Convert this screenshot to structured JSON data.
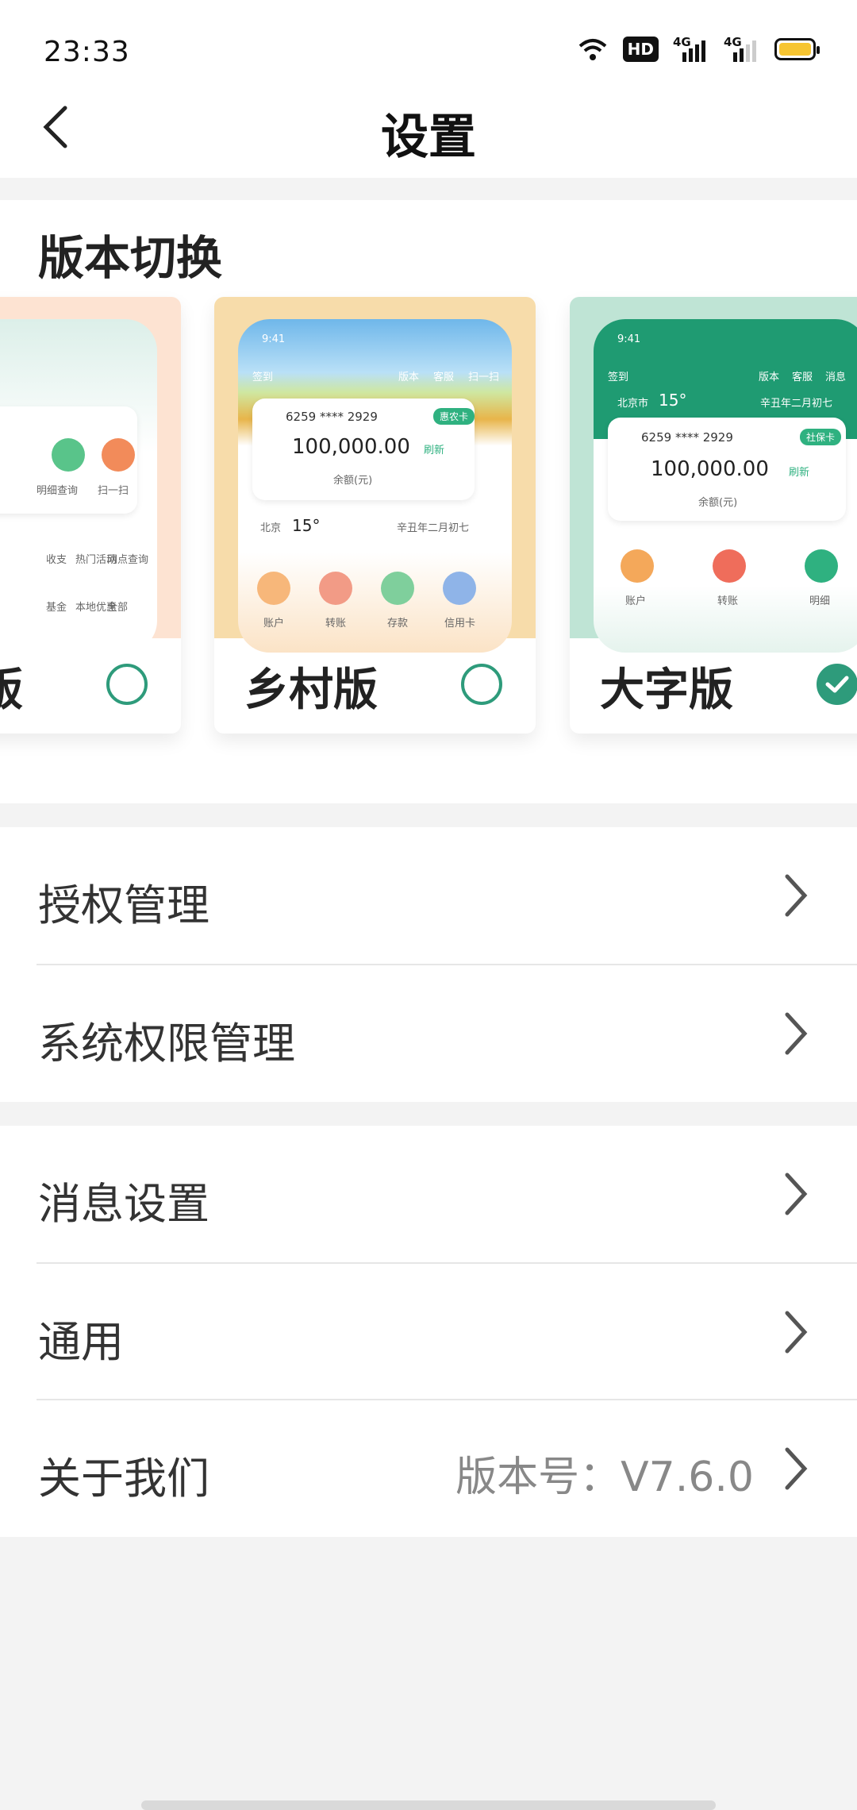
{
  "status_bar": {
    "time": "23:33",
    "hd_label": "HD",
    "network_label": "4G"
  },
  "header": {
    "title": "设置"
  },
  "version_switch": {
    "title": "版本切换",
    "options": [
      {
        "label": "标准版",
        "selected": false,
        "preview_bg": "#fde3d2",
        "preview": {
          "shortcuts": [
            "明细查询",
            "扫一扫"
          ],
          "grid": [
            "收支",
            "热门活动",
            "网点查询",
            "基金",
            "本地优惠",
            "全部"
          ]
        }
      },
      {
        "label": "乡村版",
        "selected": false,
        "preview_bg": "#f7dcaa",
        "preview": {
          "time": "9:41",
          "top_icons": [
            "签到",
            "版本",
            "客服",
            "扫一扫"
          ],
          "card_no": "6259 **** 2929",
          "tag": "惠农卡",
          "balance": "100,000.00",
          "refresh": "刷新",
          "balance_label": "余额(元)",
          "city": "北京",
          "temp": "15°",
          "lunar": "辛丑年二月初七",
          "bottom_icons": [
            "账户",
            "转账",
            "存款",
            "信用卡"
          ]
        }
      },
      {
        "label": "大字版",
        "selected": true,
        "preview_bg": "#bfe4d5",
        "preview": {
          "time": "9:41",
          "top_icons": [
            "签到",
            "版本",
            "客服",
            "消息"
          ],
          "city": "北京市",
          "temp": "15°",
          "lunar": "辛丑年二月初七",
          "card_no": "6259 **** 2929",
          "tag": "社保卡",
          "balance": "100,000.00",
          "refresh": "刷新",
          "balance_label": "余额(元)",
          "bottom_icons": [
            "账户",
            "转账",
            "明细"
          ]
        }
      }
    ]
  },
  "menu": {
    "group1": [
      {
        "label": "授权管理"
      },
      {
        "label": "系统权限管理"
      }
    ],
    "group2": [
      {
        "label": "消息设置"
      },
      {
        "label": "通用"
      },
      {
        "label": "关于我们",
        "value": "版本号：V7.6.0"
      }
    ]
  },
  "colors": {
    "accent": "#2e9b7b",
    "page_bg": "#f3f3f3",
    "battery": "#f7c531"
  }
}
